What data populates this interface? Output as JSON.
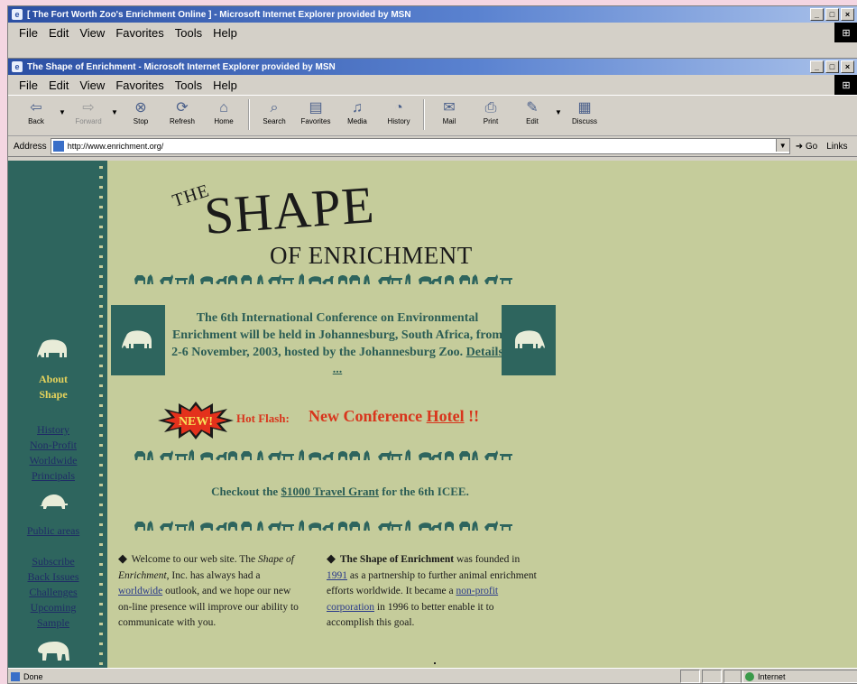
{
  "back_window": {
    "title": "[ The Fort Worth Zoo's Enrichment Online ] - Microsoft Internet Explorer provided by MSN",
    "menu": [
      "File",
      "Edit",
      "View",
      "Favorites",
      "Tools",
      "Help"
    ]
  },
  "front_window": {
    "title": "The Shape of Enrichment - Microsoft Internet Explorer provided by MSN",
    "menu": [
      "File",
      "Edit",
      "View",
      "Favorites",
      "Tools",
      "Help"
    ],
    "toolbar": {
      "back": "Back",
      "forward": "Forward",
      "stop": "Stop",
      "refresh": "Refresh",
      "home": "Home",
      "search": "Search",
      "favorites": "Favorites",
      "media": "Media",
      "history": "History",
      "mail": "Mail",
      "print": "Print",
      "edit": "Edit",
      "discuss": "Discuss"
    },
    "address": {
      "label": "Address",
      "url": "http://www.enrichment.org/",
      "go": "Go",
      "links": "Links"
    },
    "status": {
      "text": "Done",
      "zone": "Internet"
    }
  },
  "sidebar": {
    "section_label_line1": "About",
    "section_label_line2": "Shape",
    "about_links": [
      "History",
      "Non-Profit",
      "Worldwide",
      "Principals"
    ],
    "public_link": "Public areas",
    "bottom_links": [
      "Subscribe",
      "Back Issues",
      "Challenges",
      "Upcoming",
      "Sample"
    ]
  },
  "logo": {
    "the": "THE",
    "shape": "SHAPE",
    "of_enrichment": "OF ENRICHMENT"
  },
  "announcement": {
    "text": "The 6th International Conference on Environmental Enrichment will be held in Johannesburg, South Africa, from 2-6 November, 2003, hosted by the Johannesburg Zoo.",
    "details_link": "Details ..."
  },
  "hot_flash": {
    "badge": "NEW!",
    "label": "Hot Flash:",
    "text": "New Conference",
    "hotel_link": "Hotel",
    "suffix": "!!"
  },
  "travel": {
    "prefix": "Checkout the",
    "grant_link": "$1000 Travel Grant",
    "suffix": "for the 6th ICEE."
  },
  "welcome": {
    "text1": "Welcome to our web site. The",
    "italic": "Shape of Enrichment",
    "text2": ", Inc. has always had a",
    "link": "worldwide",
    "text3": "outlook, and we hope our new on-line presence will improve our ability to communicate with you."
  },
  "about_shape": {
    "bold": "The Shape of Enrichment",
    "text1": "was founded in",
    "year_link": "1991",
    "text2": "as a partnership to further animal enrichment efforts worldwide. It became a",
    "nonprofit_link": "non-profit corporation",
    "text3": "in 1996 to better enable it to accomplish this goal."
  },
  "colors": {
    "sidebar": "#2e655e",
    "page_bg": "#c5cc9b",
    "accent_text": "#2b5d55",
    "hot_red": "#d8351c",
    "sidebar_label": "#e6d35c"
  }
}
